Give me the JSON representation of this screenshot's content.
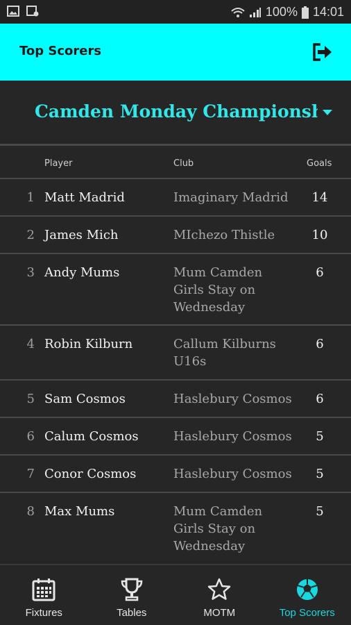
{
  "status_bar": {
    "battery": "100%",
    "time": "14:01"
  },
  "app_bar": {
    "title": "Top Scorers"
  },
  "league": {
    "name": "Camden Monday Championship"
  },
  "table": {
    "headers": {
      "player": "Player",
      "club": "Club",
      "goals": "Goals"
    },
    "rows": [
      {
        "rank": "1",
        "player": "Matt Madrid",
        "club": "Imaginary Madrid",
        "goals": "14"
      },
      {
        "rank": "2",
        "player": "James Mich",
        "club": "MIchezo Thistle",
        "goals": "10"
      },
      {
        "rank": "3",
        "player": "Andy Mums",
        "club": "Mum Camden Girls Stay on Wednesday",
        "goals": "6"
      },
      {
        "rank": "4",
        "player": "Robin Kilburn",
        "club": "Callum Kilburns U16s",
        "goals": "6"
      },
      {
        "rank": "5",
        "player": "Sam Cosmos",
        "club": "Haslebury Cosmos",
        "goals": "6"
      },
      {
        "rank": "6",
        "player": "Calum Cosmos",
        "club": "Haslebury Cosmos",
        "goals": "5"
      },
      {
        "rank": "7",
        "player": "Conor Cosmos",
        "club": "Haslebury Cosmos",
        "goals": "5"
      },
      {
        "rank": "8",
        "player": "Max Mums",
        "club": "Mum Camden Girls Stay on Wednesday",
        "goals": "5"
      }
    ]
  },
  "bottom_nav": {
    "items": [
      {
        "label": "Fixtures",
        "icon": "calendar-icon"
      },
      {
        "label": "Tables",
        "icon": "trophy-icon"
      },
      {
        "label": "MOTM",
        "icon": "star-icon"
      },
      {
        "label": "Top Scorers",
        "icon": "football-icon",
        "active": true
      }
    ]
  },
  "colors": {
    "accent": "#00ffff",
    "league_text": "#33e6e8",
    "active_tab": "#1ad8e0",
    "background": "#262626"
  }
}
